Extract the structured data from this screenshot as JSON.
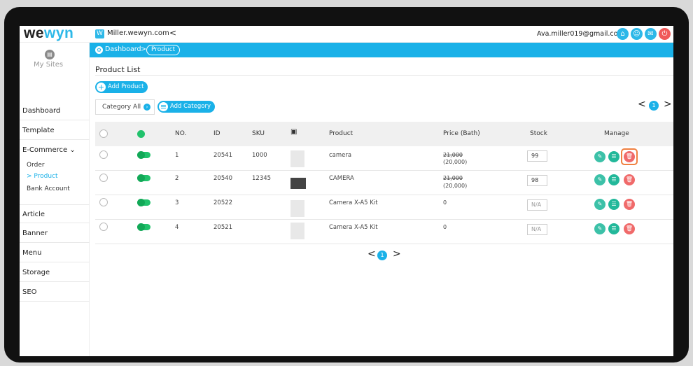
{
  "header": {
    "logo_main": "we",
    "logo_accent": "wyn",
    "site_badge": "W",
    "site_name": "Miller.wewyn.com",
    "collapse_glyph": "<",
    "email": "Ava.miller019@gmail.com",
    "icons": [
      "home-icon",
      "user-icon",
      "message-icon",
      "power-icon"
    ]
  },
  "breadcrumb": {
    "home_glyph": "⚙",
    "dashboard": "Dashboard",
    "separator": ">",
    "current": "Product"
  },
  "sidebar": {
    "my_sites": "My Sites",
    "items": [
      {
        "label": "Dashboard"
      },
      {
        "label": "Template"
      },
      {
        "label": "E-Commerce ⌄"
      },
      {
        "label": "Article"
      },
      {
        "label": "Banner"
      },
      {
        "label": "Menu"
      },
      {
        "label": "Storage"
      },
      {
        "label": "SEO"
      }
    ],
    "sub_items": [
      {
        "label": "Order"
      },
      {
        "label": "> Product"
      },
      {
        "label": "Bank Account"
      }
    ]
  },
  "main": {
    "title": "Product List",
    "add_product": "Add Product",
    "category_label": "Category All",
    "add_category": "Add Category",
    "page": "1",
    "prev": "<",
    "next": ">"
  },
  "table": {
    "headers": [
      "NO.",
      "ID",
      "SKU",
      "Product",
      "Price (Bath)",
      "Stock",
      "Manage"
    ],
    "rows": [
      {
        "no": "1",
        "id": "20541",
        "sku": "1000",
        "product": "camera",
        "price_old": "21,000",
        "price_new": "(20,000)",
        "stock": "99"
      },
      {
        "no": "2",
        "id": "20540",
        "sku": "12345",
        "product": "CAMERA",
        "price_old": "21,000",
        "price_new": "(20,000)",
        "stock": "98"
      },
      {
        "no": "3",
        "id": "20522",
        "sku": "",
        "product": "Camera X-A5 Kit",
        "price_old": "",
        "price_new": "0",
        "stock": "N/A"
      },
      {
        "no": "4",
        "id": "20521",
        "sku": "",
        "product": "Camera X-A5 Kit",
        "price_old": "",
        "price_new": "0",
        "stock": "N/A"
      }
    ]
  },
  "colors": {
    "accent": "#1ab1e8",
    "green": "#21c26c",
    "delete": "#f06a6a",
    "highlight": "#f08040"
  }
}
